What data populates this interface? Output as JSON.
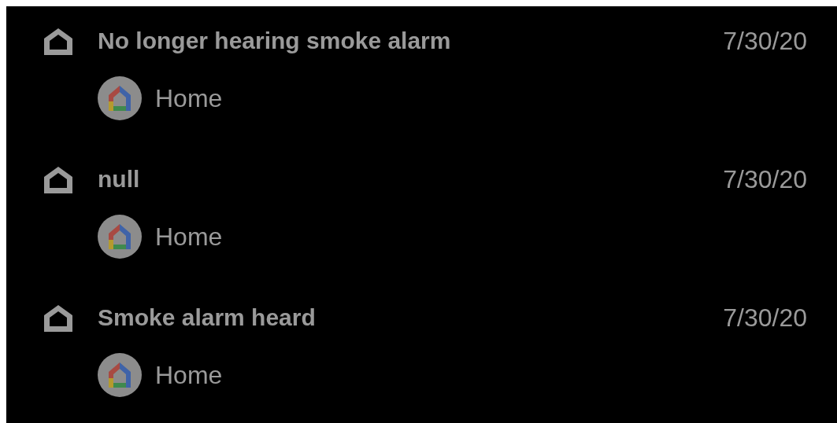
{
  "notifications": [
    {
      "title": "No longer hearing smoke alarm",
      "date": "7/30/20",
      "source": "Home"
    },
    {
      "title": "null",
      "date": "7/30/20",
      "source": "Home"
    },
    {
      "title": "Smoke alarm heard",
      "date": "7/30/20",
      "source": "Home"
    }
  ]
}
